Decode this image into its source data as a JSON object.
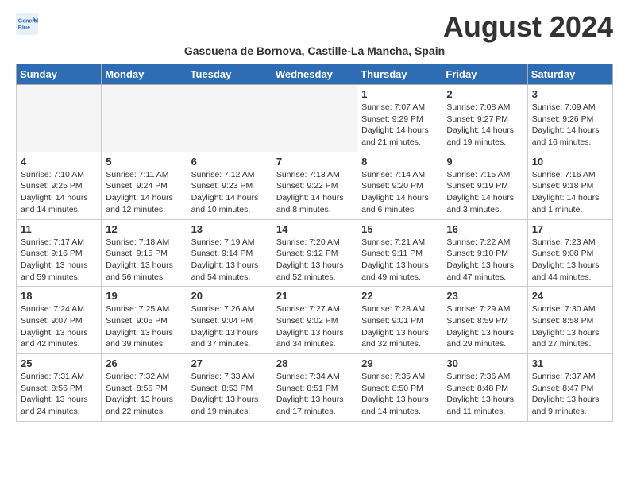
{
  "header": {
    "logo_line1": "General",
    "logo_line2": "Blue",
    "month_title": "August 2024",
    "subtitle": "Gascuena de Bornova, Castille-La Mancha, Spain"
  },
  "weekdays": [
    "Sunday",
    "Monday",
    "Tuesday",
    "Wednesday",
    "Thursday",
    "Friday",
    "Saturday"
  ],
  "weeks": [
    {
      "row_class": "week-row-1",
      "days": [
        {
          "num": "",
          "info": "",
          "empty": true
        },
        {
          "num": "",
          "info": "",
          "empty": true
        },
        {
          "num": "",
          "info": "",
          "empty": true
        },
        {
          "num": "",
          "info": "",
          "empty": true
        },
        {
          "num": "1",
          "info": "Sunrise: 7:07 AM\nSunset: 9:29 PM\nDaylight: 14 hours and 21 minutes.",
          "empty": false
        },
        {
          "num": "2",
          "info": "Sunrise: 7:08 AM\nSunset: 9:27 PM\nDaylight: 14 hours and 19 minutes.",
          "empty": false
        },
        {
          "num": "3",
          "info": "Sunrise: 7:09 AM\nSunset: 9:26 PM\nDaylight: 14 hours and 16 minutes.",
          "empty": false
        }
      ]
    },
    {
      "row_class": "week-row-2",
      "days": [
        {
          "num": "4",
          "info": "Sunrise: 7:10 AM\nSunset: 9:25 PM\nDaylight: 14 hours and 14 minutes.",
          "empty": false
        },
        {
          "num": "5",
          "info": "Sunrise: 7:11 AM\nSunset: 9:24 PM\nDaylight: 14 hours and 12 minutes.",
          "empty": false
        },
        {
          "num": "6",
          "info": "Sunrise: 7:12 AM\nSunset: 9:23 PM\nDaylight: 14 hours and 10 minutes.",
          "empty": false
        },
        {
          "num": "7",
          "info": "Sunrise: 7:13 AM\nSunset: 9:22 PM\nDaylight: 14 hours and 8 minutes.",
          "empty": false
        },
        {
          "num": "8",
          "info": "Sunrise: 7:14 AM\nSunset: 9:20 PM\nDaylight: 14 hours and 6 minutes.",
          "empty": false
        },
        {
          "num": "9",
          "info": "Sunrise: 7:15 AM\nSunset: 9:19 PM\nDaylight: 14 hours and 3 minutes.",
          "empty": false
        },
        {
          "num": "10",
          "info": "Sunrise: 7:16 AM\nSunset: 9:18 PM\nDaylight: 14 hours and 1 minute.",
          "empty": false
        }
      ]
    },
    {
      "row_class": "week-row-3",
      "days": [
        {
          "num": "11",
          "info": "Sunrise: 7:17 AM\nSunset: 9:16 PM\nDaylight: 13 hours and 59 minutes.",
          "empty": false
        },
        {
          "num": "12",
          "info": "Sunrise: 7:18 AM\nSunset: 9:15 PM\nDaylight: 13 hours and 56 minutes.",
          "empty": false
        },
        {
          "num": "13",
          "info": "Sunrise: 7:19 AM\nSunset: 9:14 PM\nDaylight: 13 hours and 54 minutes.",
          "empty": false
        },
        {
          "num": "14",
          "info": "Sunrise: 7:20 AM\nSunset: 9:12 PM\nDaylight: 13 hours and 52 minutes.",
          "empty": false
        },
        {
          "num": "15",
          "info": "Sunrise: 7:21 AM\nSunset: 9:11 PM\nDaylight: 13 hours and 49 minutes.",
          "empty": false
        },
        {
          "num": "16",
          "info": "Sunrise: 7:22 AM\nSunset: 9:10 PM\nDaylight: 13 hours and 47 minutes.",
          "empty": false
        },
        {
          "num": "17",
          "info": "Sunrise: 7:23 AM\nSunset: 9:08 PM\nDaylight: 13 hours and 44 minutes.",
          "empty": false
        }
      ]
    },
    {
      "row_class": "week-row-4",
      "days": [
        {
          "num": "18",
          "info": "Sunrise: 7:24 AM\nSunset: 9:07 PM\nDaylight: 13 hours and 42 minutes.",
          "empty": false
        },
        {
          "num": "19",
          "info": "Sunrise: 7:25 AM\nSunset: 9:05 PM\nDaylight: 13 hours and 39 minutes.",
          "empty": false
        },
        {
          "num": "20",
          "info": "Sunrise: 7:26 AM\nSunset: 9:04 PM\nDaylight: 13 hours and 37 minutes.",
          "empty": false
        },
        {
          "num": "21",
          "info": "Sunrise: 7:27 AM\nSunset: 9:02 PM\nDaylight: 13 hours and 34 minutes.",
          "empty": false
        },
        {
          "num": "22",
          "info": "Sunrise: 7:28 AM\nSunset: 9:01 PM\nDaylight: 13 hours and 32 minutes.",
          "empty": false
        },
        {
          "num": "23",
          "info": "Sunrise: 7:29 AM\nSunset: 8:59 PM\nDaylight: 13 hours and 29 minutes.",
          "empty": false
        },
        {
          "num": "24",
          "info": "Sunrise: 7:30 AM\nSunset: 8:58 PM\nDaylight: 13 hours and 27 minutes.",
          "empty": false
        }
      ]
    },
    {
      "row_class": "week-row-5",
      "days": [
        {
          "num": "25",
          "info": "Sunrise: 7:31 AM\nSunset: 8:56 PM\nDaylight: 13 hours and 24 minutes.",
          "empty": false
        },
        {
          "num": "26",
          "info": "Sunrise: 7:32 AM\nSunset: 8:55 PM\nDaylight: 13 hours and 22 minutes.",
          "empty": false
        },
        {
          "num": "27",
          "info": "Sunrise: 7:33 AM\nSunset: 8:53 PM\nDaylight: 13 hours and 19 minutes.",
          "empty": false
        },
        {
          "num": "28",
          "info": "Sunrise: 7:34 AM\nSunset: 8:51 PM\nDaylight: 13 hours and 17 minutes.",
          "empty": false
        },
        {
          "num": "29",
          "info": "Sunrise: 7:35 AM\nSunset: 8:50 PM\nDaylight: 13 hours and 14 minutes.",
          "empty": false
        },
        {
          "num": "30",
          "info": "Sunrise: 7:36 AM\nSunset: 8:48 PM\nDaylight: 13 hours and 11 minutes.",
          "empty": false
        },
        {
          "num": "31",
          "info": "Sunrise: 7:37 AM\nSunset: 8:47 PM\nDaylight: 13 hours and 9 minutes.",
          "empty": false
        }
      ]
    }
  ]
}
